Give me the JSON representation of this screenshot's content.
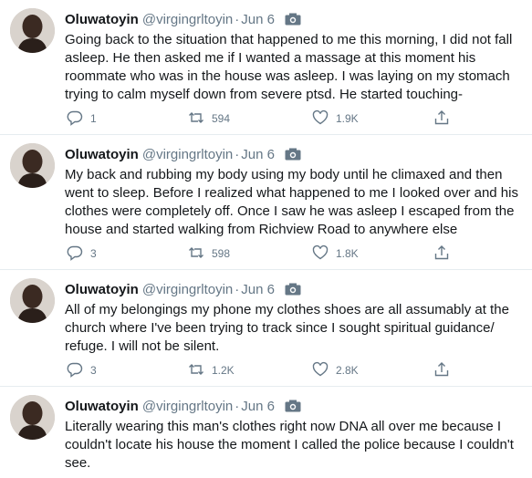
{
  "tweets": [
    {
      "name": "Oluwatoyin",
      "handle": "@virgingrltoyin",
      "date": "Jun 6",
      "text": "Going back to the situation that happened to me this morning, I did not fall asleep. He then asked me if I wanted a massage at this moment his roommate who was in the house was asleep. I was laying on my stomach trying to calm myself down from severe ptsd. He started touching-",
      "replies": "1",
      "retweets": "594",
      "likes": "1.9K"
    },
    {
      "name": "Oluwatoyin",
      "handle": "@virgingrltoyin",
      "date": "Jun 6",
      "text": "My back and rubbing my body using my body until he climaxed and then went to sleep. Before I realized what happened to me I looked over and his clothes were completely off. Once I saw he was asleep I escaped from the house and started walking from Richview Road to anywhere else",
      "replies": "3",
      "retweets": "598",
      "likes": "1.8K"
    },
    {
      "name": "Oluwatoyin",
      "handle": "@virgingrltoyin",
      "date": "Jun 6",
      "text": "All of my belongings my phone my clothes shoes are all assumably at the church where I've been trying to track since I sought spiritual guidance/ refuge. I will not be silent.",
      "replies": "3",
      "retweets": "1.2K",
      "likes": "2.8K"
    },
    {
      "name": "Oluwatoyin",
      "handle": "@virgingrltoyin",
      "date": "Jun 6",
      "text": "Literally wearing this man's clothes right now DNA all over me because I couldn't locate his house the moment I called the police because I couldn't see."
    }
  ],
  "colors": {
    "text": "#14171a",
    "secondary": "#657786",
    "divider": "#e6ecf0"
  },
  "icons": {
    "media": "camera-icon",
    "reply": "reply-icon",
    "retweet": "retweet-icon",
    "like": "heart-icon",
    "share": "share-icon"
  }
}
